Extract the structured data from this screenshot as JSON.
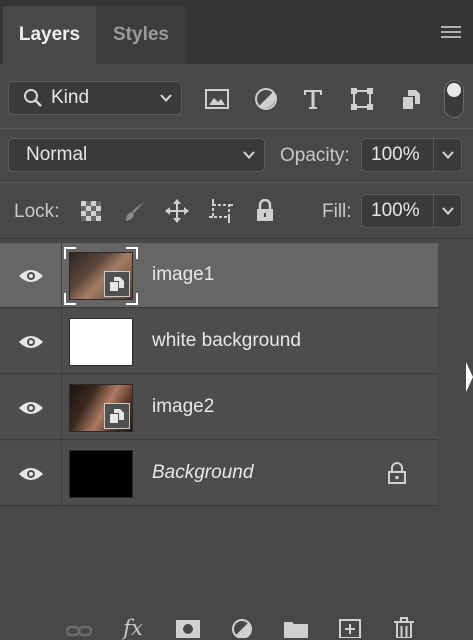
{
  "tabs": [
    {
      "label": "Layers",
      "active": true
    },
    {
      "label": "Styles",
      "active": false
    }
  ],
  "filter": {
    "kind_label": "Kind",
    "icons": [
      "image-filter-icon",
      "adjustment-filter-icon",
      "type-filter-icon",
      "shape-filter-icon",
      "smart-object-filter-icon"
    ],
    "filter_toggle_on": true
  },
  "blend": {
    "mode": "Normal",
    "opacity_label": "Opacity:",
    "opacity_value": "100%"
  },
  "lock": {
    "label": "Lock:",
    "icons": [
      "lock-transparent-pixels-icon",
      "lock-image-pixels-icon",
      "lock-position-icon",
      "lock-artboard-icon",
      "lock-all-icon"
    ],
    "fill_label": "Fill:",
    "fill_value": "100%"
  },
  "layers": [
    {
      "name": "image1",
      "visible": true,
      "selected": true,
      "thumbnail": "face-photo",
      "smart_object": true,
      "italic": false,
      "locked": false
    },
    {
      "name": "white background",
      "visible": true,
      "selected": false,
      "thumbnail": "white",
      "smart_object": false,
      "italic": false,
      "locked": false
    },
    {
      "name": "image2",
      "visible": true,
      "selected": false,
      "thumbnail": "face-photo",
      "smart_object": true,
      "italic": false,
      "locked": false
    },
    {
      "name": "Background",
      "visible": true,
      "selected": false,
      "thumbnail": "black",
      "smart_object": false,
      "italic": true,
      "locked": true
    }
  ],
  "bottom_bar": {
    "icons": [
      "link-layers-icon",
      "layer-style-fx-icon",
      "add-mask-icon",
      "adjustment-layer-icon",
      "new-group-icon",
      "new-layer-icon",
      "delete-layer-icon"
    ],
    "fx_label": "fx"
  },
  "colors": {
    "panel_bg": "#484848",
    "tab_bar_bg": "#353535",
    "selected_row": "#666666",
    "row_bg": "#4d4d4d"
  }
}
